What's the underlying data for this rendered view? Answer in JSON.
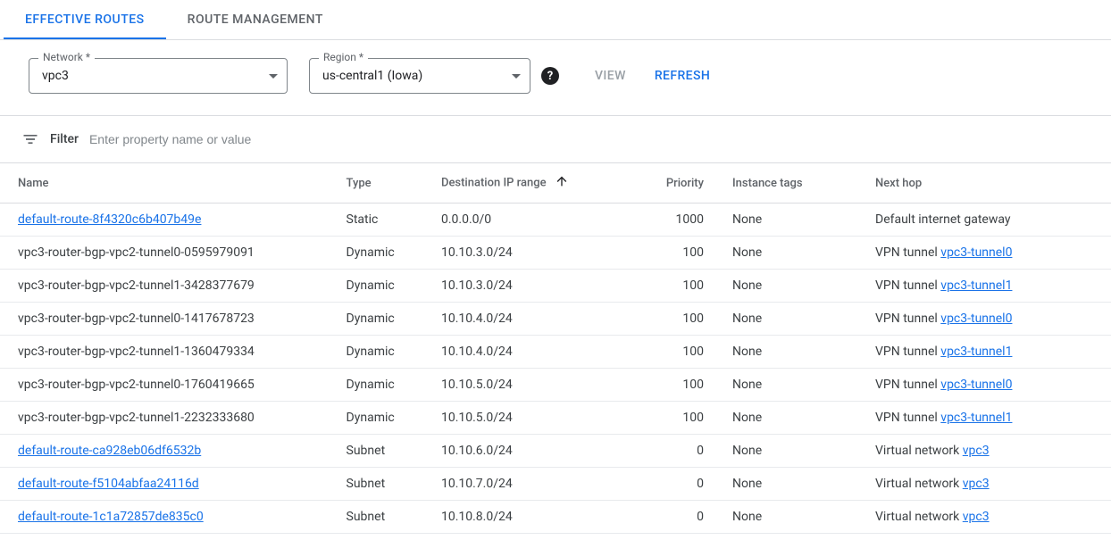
{
  "tabs": {
    "effective": "EFFECTIVE ROUTES",
    "management": "ROUTE MANAGEMENT"
  },
  "controls": {
    "network_label": "Network *",
    "network_value": "vpc3",
    "region_label": "Region *",
    "region_value": "us-central1 (Iowa)",
    "help_glyph": "?",
    "view_label": "VIEW",
    "refresh_label": "REFRESH"
  },
  "filter": {
    "label": "Filter",
    "placeholder": "Enter property name or value"
  },
  "columns": {
    "name": "Name",
    "type": "Type",
    "dest": "Destination IP range",
    "priority": "Priority",
    "tags": "Instance tags",
    "next": "Next hop"
  },
  "rows": [
    {
      "name": "default-route-8f4320c6b407b49e",
      "name_link": true,
      "type": "Static",
      "dest": "0.0.0.0/0",
      "priority": "1000",
      "tags": "None",
      "next_prefix": "Default internet gateway",
      "next_link": ""
    },
    {
      "name": "vpc3-router-bgp-vpc2-tunnel0-0595979091",
      "name_link": false,
      "type": "Dynamic",
      "dest": "10.10.3.0/24",
      "priority": "100",
      "tags": "None",
      "next_prefix": "VPN tunnel ",
      "next_link": "vpc3-tunnel0"
    },
    {
      "name": "vpc3-router-bgp-vpc2-tunnel1-3428377679",
      "name_link": false,
      "type": "Dynamic",
      "dest": "10.10.3.0/24",
      "priority": "100",
      "tags": "None",
      "next_prefix": "VPN tunnel ",
      "next_link": "vpc3-tunnel1"
    },
    {
      "name": "vpc3-router-bgp-vpc2-tunnel0-1417678723",
      "name_link": false,
      "type": "Dynamic",
      "dest": "10.10.4.0/24",
      "priority": "100",
      "tags": "None",
      "next_prefix": "VPN tunnel ",
      "next_link": "vpc3-tunnel0"
    },
    {
      "name": "vpc3-router-bgp-vpc2-tunnel1-1360479334",
      "name_link": false,
      "type": "Dynamic",
      "dest": "10.10.4.0/24",
      "priority": "100",
      "tags": "None",
      "next_prefix": "VPN tunnel ",
      "next_link": "vpc3-tunnel1"
    },
    {
      "name": "vpc3-router-bgp-vpc2-tunnel0-1760419665",
      "name_link": false,
      "type": "Dynamic",
      "dest": "10.10.5.0/24",
      "priority": "100",
      "tags": "None",
      "next_prefix": "VPN tunnel ",
      "next_link": "vpc3-tunnel0"
    },
    {
      "name": "vpc3-router-bgp-vpc2-tunnel1-2232333680",
      "name_link": false,
      "type": "Dynamic",
      "dest": "10.10.5.0/24",
      "priority": "100",
      "tags": "None",
      "next_prefix": "VPN tunnel ",
      "next_link": "vpc3-tunnel1"
    },
    {
      "name": "default-route-ca928eb06df6532b",
      "name_link": true,
      "type": "Subnet",
      "dest": "10.10.6.0/24",
      "priority": "0",
      "tags": "None",
      "next_prefix": "Virtual network ",
      "next_link": "vpc3"
    },
    {
      "name": "default-route-f5104abfaa24116d",
      "name_link": true,
      "type": "Subnet",
      "dest": "10.10.7.0/24",
      "priority": "0",
      "tags": "None",
      "next_prefix": "Virtual network ",
      "next_link": "vpc3"
    },
    {
      "name": "default-route-1c1a72857de835c0",
      "name_link": true,
      "type": "Subnet",
      "dest": "10.10.8.0/24",
      "priority": "0",
      "tags": "None",
      "next_prefix": "Virtual network ",
      "next_link": "vpc3"
    }
  ]
}
